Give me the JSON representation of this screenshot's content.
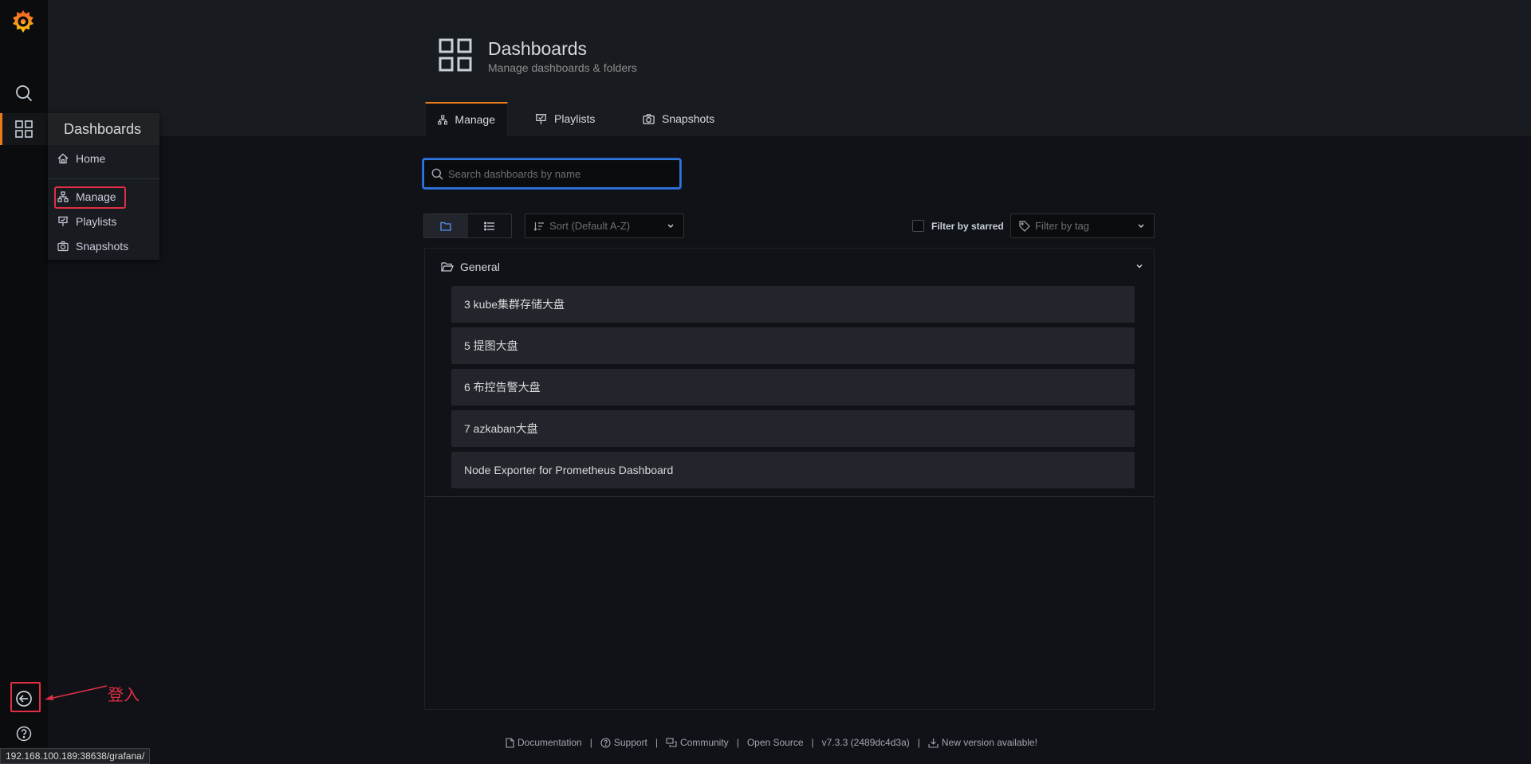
{
  "sidebar": {
    "dropdown": {
      "title": "Dashboards",
      "items": [
        {
          "label": "Home",
          "icon": "home-icon"
        },
        {
          "label": "Manage",
          "icon": "sitemap-icon"
        },
        {
          "label": "Playlists",
          "icon": "presentation-icon"
        },
        {
          "label": "Snapshots",
          "icon": "camera-icon"
        }
      ]
    }
  },
  "header": {
    "title": "Dashboards",
    "subtitle": "Manage dashboards & folders",
    "tabs": [
      {
        "label": "Manage",
        "active": true
      },
      {
        "label": "Playlists",
        "active": false
      },
      {
        "label": "Snapshots",
        "active": false
      }
    ]
  },
  "search": {
    "placeholder": "Search dashboards by name",
    "value": ""
  },
  "toolbar": {
    "sort_placeholder": "Sort (Default A-Z)",
    "starred_label": "Filter by starred",
    "starred_checked": false,
    "tag_placeholder": "Filter by tag",
    "view_mode": "folders"
  },
  "folder": {
    "name": "General",
    "dashboards": [
      "3 kube集群存储大盘",
      "5 提图大盘",
      "6 布控告警大盘",
      "7 azkaban大盘",
      "Node Exporter for Prometheus Dashboard"
    ]
  },
  "footer": {
    "documentation": "Documentation",
    "support": "Support",
    "community": "Community",
    "open_source": "Open Source",
    "version": "v7.3.3 (2489dc4d3a)",
    "new_version": "New version available!"
  },
  "status_url": "192.168.100.189:38638/grafana/",
  "annotation": {
    "text": "登入"
  },
  "colors": {
    "accent": "#eb7b18",
    "focus": "#3274d9",
    "annotation": "#e02f44"
  }
}
